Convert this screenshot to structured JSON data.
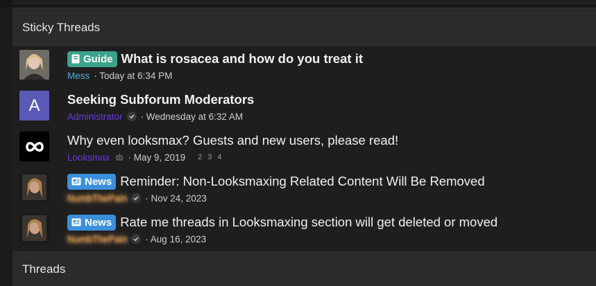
{
  "sticky_header": "Sticky Threads",
  "threads_header": "Threads",
  "threads": [
    {
      "avatar_type": "photo",
      "label": "Guide",
      "label_icon": "book-icon",
      "title": "What is rosacea and how do you treat it",
      "author": "Mess",
      "date": "· Today at 6:34 PM"
    },
    {
      "avatar_type": "letter",
      "avatar_letter": "A",
      "title": "Seeking Subforum Moderators",
      "author": "Administrator",
      "date": "· Wednesday at 6:32 AM"
    },
    {
      "avatar_type": "logo",
      "title": "Why even looksmax? Guests and new users, please read!",
      "author": "Looksmax",
      "date": "· May 9, 2019",
      "pages": [
        "2",
        "3",
        "4"
      ]
    },
    {
      "avatar_type": "photo",
      "label": "News",
      "label_icon": "newspaper-icon",
      "title": "Reminder: Non-Looksmaxing Related Content Will Be Removed",
      "author": "NumbThePain",
      "date": "· Nov 24, 2023"
    },
    {
      "avatar_type": "photo",
      "label": "News",
      "label_icon": "newspaper-icon",
      "title": "Rate me threads in Looksmaxing section will get deleted or moved",
      "author": "NumbThePain",
      "date": "· Aug 16, 2023"
    }
  ],
  "colors": {
    "guide_label": "#3aa38a",
    "news_label": "#3b8fdc",
    "mess_user": "#4fb0d8",
    "admin_user": "#6a38d8",
    "avatar_letter_bg": "#5a59b8"
  }
}
